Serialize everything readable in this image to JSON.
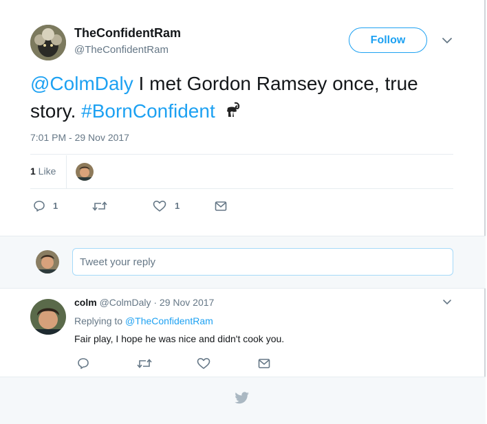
{
  "tweet": {
    "author_name": "TheConfidentRam",
    "author_handle": "@TheConfidentRam",
    "follow_label": "Follow",
    "mention": "@ColmDaly",
    "text_part1": " I met Gordon Ramsey once, true",
    "text_part2": "story. ",
    "hashtag": "#BornConfident",
    "timestamp": "7:01 PM - 29 Nov 2017",
    "likes_count": "1",
    "likes_label": " Like",
    "reply_count": "1",
    "like_count": "1"
  },
  "reply_box": {
    "placeholder": "Tweet your reply"
  },
  "reply": {
    "author_name": "colm",
    "author_handle": "@ColmDaly",
    "date": " · 29 Nov 2017",
    "replying_to_label": "Replying to ",
    "replying_to_handle": "@TheConfidentRam",
    "text": "Fair play, I hope he was nice and didn't cook you."
  },
  "colors": {
    "accent": "#1da1f2",
    "muted": "#657786",
    "text": "#14171a",
    "divider": "#e6ecf0",
    "background_alt": "#f5f8fa"
  },
  "icons": [
    "reply-icon",
    "retweet-icon",
    "like-icon",
    "dm-icon",
    "chevron-down-icon",
    "ram-emoji-icon",
    "twitter-bird-icon"
  ]
}
